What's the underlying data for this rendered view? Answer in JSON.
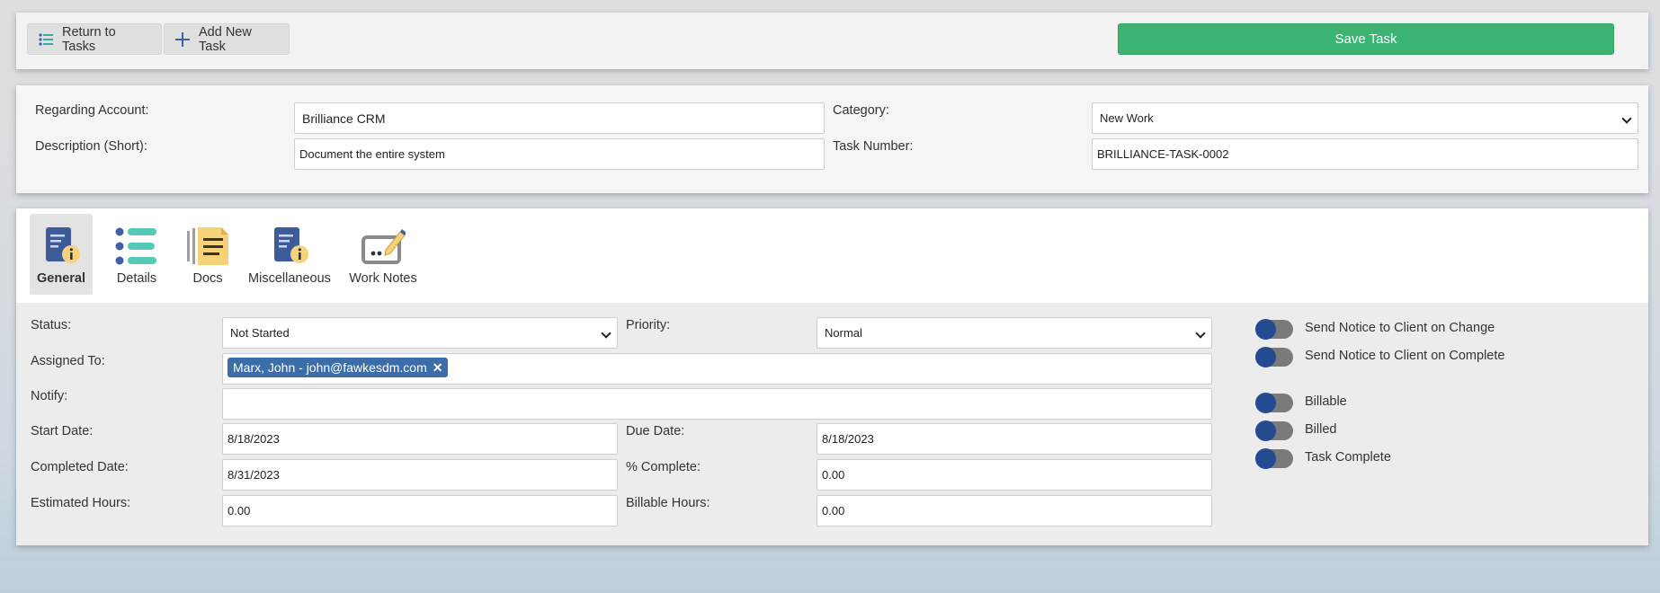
{
  "toolbar": {
    "return_label": "Return to Tasks",
    "add_label": "Add New Task",
    "save_label": "Save Task"
  },
  "header": {
    "regarding_account_label": "Regarding Account:",
    "regarding_account_value": "Brilliance CRM",
    "category_label": "Category:",
    "category_value": "New Work",
    "description_label": "Description (Short):",
    "description_value": "Document the entire system",
    "task_number_label": "Task Number:",
    "task_number_value": "BRILLIANCE-TASK-0002"
  },
  "tabs": [
    {
      "label": "General",
      "icon": "document-info-icon",
      "active": true
    },
    {
      "label": "Details",
      "icon": "list-icon",
      "active": false
    },
    {
      "label": "Docs",
      "icon": "docs-icon",
      "active": false
    },
    {
      "label": "Miscellaneous",
      "icon": "document-info-icon",
      "active": false
    },
    {
      "label": "Work Notes",
      "icon": "work-notes-icon",
      "active": false
    }
  ],
  "general": {
    "status_label": "Status:",
    "status_value": "Not Started",
    "priority_label": "Priority:",
    "priority_value": "Normal",
    "assigned_label": "Assigned To:",
    "assigned_chip": "Marx, John - john@fawkesdm.com",
    "notify_label": "Notify:",
    "start_label": "Start Date:",
    "start_value": "8/18/2023",
    "due_label": "Due Date:",
    "due_value": "8/18/2023",
    "completed_label": "Completed Date:",
    "completed_value": "8/31/2023",
    "percent_label": "% Complete:",
    "percent_value": "0.00",
    "est_hours_label": "Estimated Hours:",
    "est_hours_value": "0.00",
    "billable_hours_label": "Billable Hours:",
    "billable_hours_value": "0.00"
  },
  "toggles": [
    {
      "label": "Send Notice to Client on Change",
      "on": false
    },
    {
      "label": "Send Notice to Client on Complete",
      "on": false
    },
    {
      "label": "Billable",
      "on": false
    },
    {
      "label": "Billed",
      "on": false
    },
    {
      "label": "Task Complete",
      "on": false
    }
  ],
  "colors": {
    "save_button": "#3cb371",
    "chip": "#3b6ea8",
    "toggle_knob": "#244a8f",
    "toggle_track": "#7a7a7a"
  }
}
